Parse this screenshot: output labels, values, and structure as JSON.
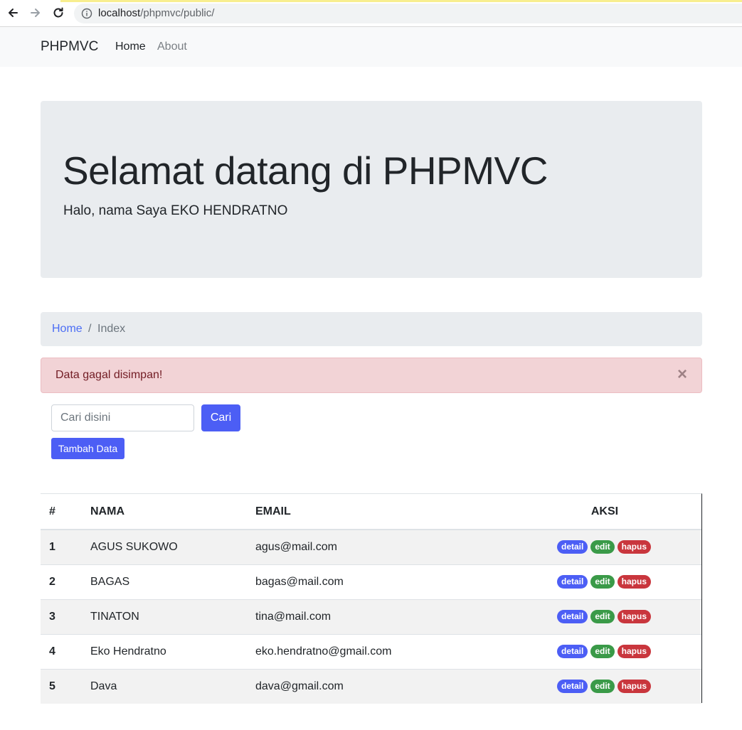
{
  "browser": {
    "url_host": "localhost",
    "url_path": "/phpmvc/public/"
  },
  "navbar": {
    "brand": "PHPMVC",
    "links": [
      {
        "label": "Home"
      },
      {
        "label": "About"
      }
    ]
  },
  "jumbotron": {
    "title": "Selamat datang di PHPMVC",
    "subtitle": "Halo, nama Saya EKO HENDRATNO"
  },
  "breadcrumb": {
    "home": "Home",
    "separator": "/",
    "active": "Index"
  },
  "alert": {
    "message": "Data gagal disimpan!",
    "close": "×"
  },
  "search": {
    "placeholder": "Cari disini",
    "button": "Cari"
  },
  "add_button": "Tambah Data",
  "table": {
    "headers": [
      "#",
      "NAMA",
      "EMAIL",
      "AKSI"
    ],
    "rows": [
      {
        "num": "1",
        "nama": "AGUS SUKOWO",
        "email": "agus@mail.com"
      },
      {
        "num": "2",
        "nama": "BAGAS",
        "email": "bagas@mail.com"
      },
      {
        "num": "3",
        "nama": "TINATON",
        "email": "tina@mail.com"
      },
      {
        "num": "4",
        "nama": "Eko Hendratno",
        "email": "eko.hendratno@gmail.com"
      },
      {
        "num": "5",
        "nama": "Dava",
        "email": "dava@gmail.com"
      }
    ],
    "actions": {
      "detail": "detail",
      "edit": "edit",
      "hapus": "hapus"
    }
  },
  "colors": {
    "primary": "#4c5ef5",
    "success": "#3a9a48",
    "danger": "#c9363d",
    "alert_bg": "#f2d3d6"
  }
}
